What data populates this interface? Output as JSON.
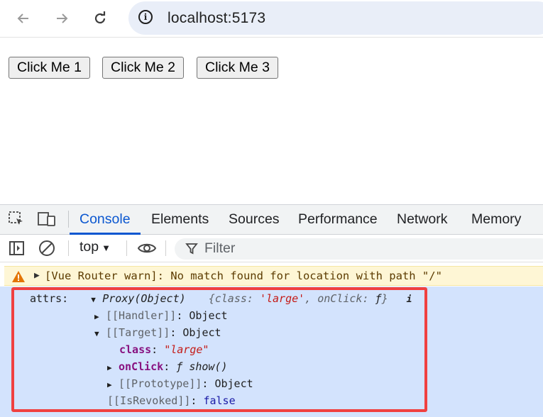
{
  "browser": {
    "url": "localhost:5173",
    "icons": [
      "back-arrow-icon",
      "forward-arrow-icon",
      "reload-icon",
      "site-info-icon"
    ]
  },
  "page": {
    "buttons": [
      "Click Me 1",
      "Click Me 2",
      "Click Me 3"
    ]
  },
  "devtools": {
    "tabs": [
      "Console",
      "Elements",
      "Sources",
      "Performance",
      "Network",
      "Memory"
    ],
    "active_tab": "Console",
    "toolbar": {
      "context": "top",
      "filter_placeholder": "Filter"
    },
    "console": {
      "warning": "[Vue Router warn]: No match found for location with path \"/\"",
      "log": {
        "label": "attrs:",
        "summary_type": "Proxy(Object)",
        "summary_open": "{",
        "summary_class_key": "class:",
        "summary_class_value": "'large'",
        "summary_sep": ",",
        "summary_onclick_key": "onClick:",
        "summary_onclick_value": "ƒ",
        "summary_close": "}",
        "info_badge": "i",
        "handler_key": "[[Handler]]",
        "handler_value": "Object",
        "target_key": "[[Target]]",
        "target_value": "Object",
        "class_key": "class",
        "class_value": "\"large\"",
        "onclick_key": "onClick",
        "onclick_value_f": "ƒ",
        "onclick_value_name": "show()",
        "prototype_key": "[[Prototype]]",
        "prototype_value": "Object",
        "revoked_key": "[[IsRevoked]]",
        "revoked_value": "false",
        "colon": ":"
      }
    }
  },
  "colors": {
    "accent": "#0b57d0",
    "warning_bg": "#fef6d5",
    "selected_log_bg": "#d3e3fd",
    "highlight_border": "#f04040"
  }
}
